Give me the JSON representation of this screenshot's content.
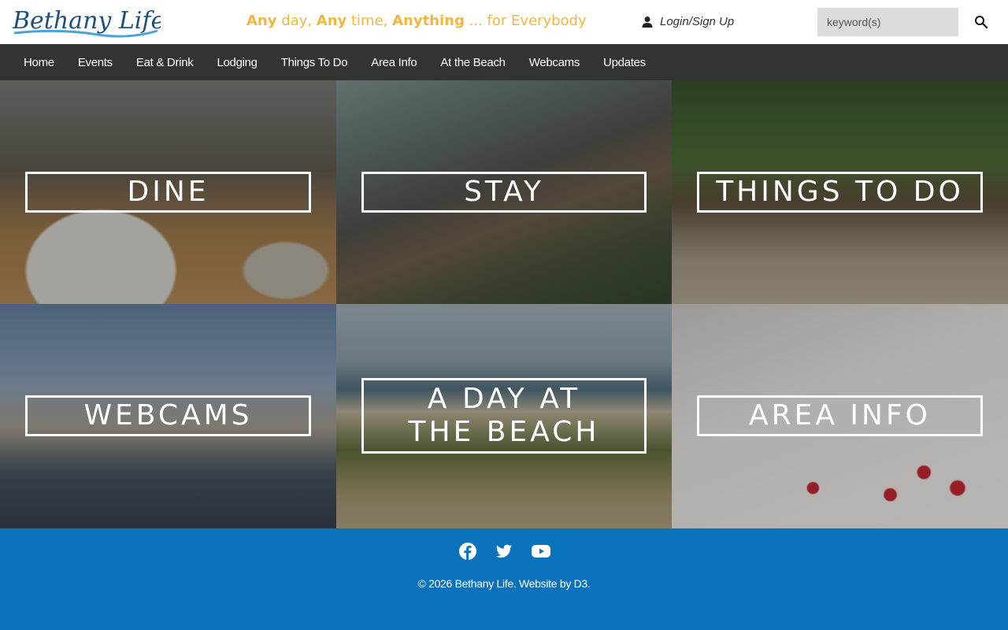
{
  "header": {
    "logo_text": "Bethany Life",
    "tagline": {
      "any1": "Any",
      "day": " day, ",
      "any2": "Any",
      "time": " time, ",
      "anything": "Anything",
      "rest": " ... for Everybody"
    },
    "login_label": "Login/Sign Up",
    "search_placeholder": "keyword(s)"
  },
  "nav": {
    "items": [
      "Home",
      "Events",
      "Eat & Drink",
      "Lodging",
      "Things To Do",
      "Area Info",
      "At the Beach",
      "Webcams",
      "Updates"
    ]
  },
  "tiles": [
    {
      "label": "DINE"
    },
    {
      "label": "STAY"
    },
    {
      "label": "THINGS TO DO"
    },
    {
      "label": "WEBCAMS"
    },
    {
      "label": "A DAY AT THE BEACH"
    },
    {
      "label": "AREA INFO"
    }
  ],
  "footer": {
    "copyright": "© 2026 Bethany Life. Website by D3.",
    "social_icons": [
      "facebook-icon",
      "twitter-icon",
      "youtube-icon"
    ]
  },
  "colors": {
    "tagline": "#f3b63f",
    "nav_bg": "#333333",
    "footer_bg": "#0a72ba",
    "logo_blue": "#1d4f7c"
  }
}
